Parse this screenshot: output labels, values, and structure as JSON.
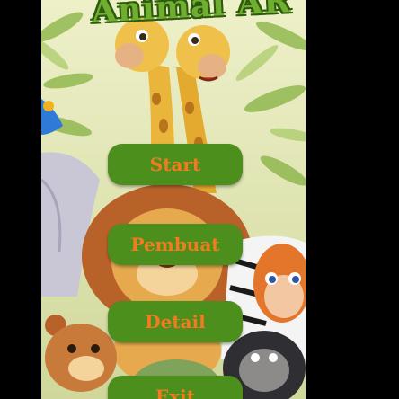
{
  "app": {
    "title": "Animal AR"
  },
  "menu": {
    "buttons": [
      {
        "label": "Start"
      },
      {
        "label": "Pembuat"
      },
      {
        "label": "Detail"
      },
      {
        "label": "Exit"
      }
    ]
  },
  "colors": {
    "button_bg": "#4d8f1c",
    "button_text": "#f47a20",
    "title_fill": "#6fae2e",
    "letterbox": "#000000"
  },
  "illustrations": [
    "giraffe",
    "giraffe",
    "lion",
    "elephant",
    "zebra",
    "monkey",
    "bear",
    "gorilla",
    "turtle",
    "parrot",
    "jungle-leaves"
  ]
}
